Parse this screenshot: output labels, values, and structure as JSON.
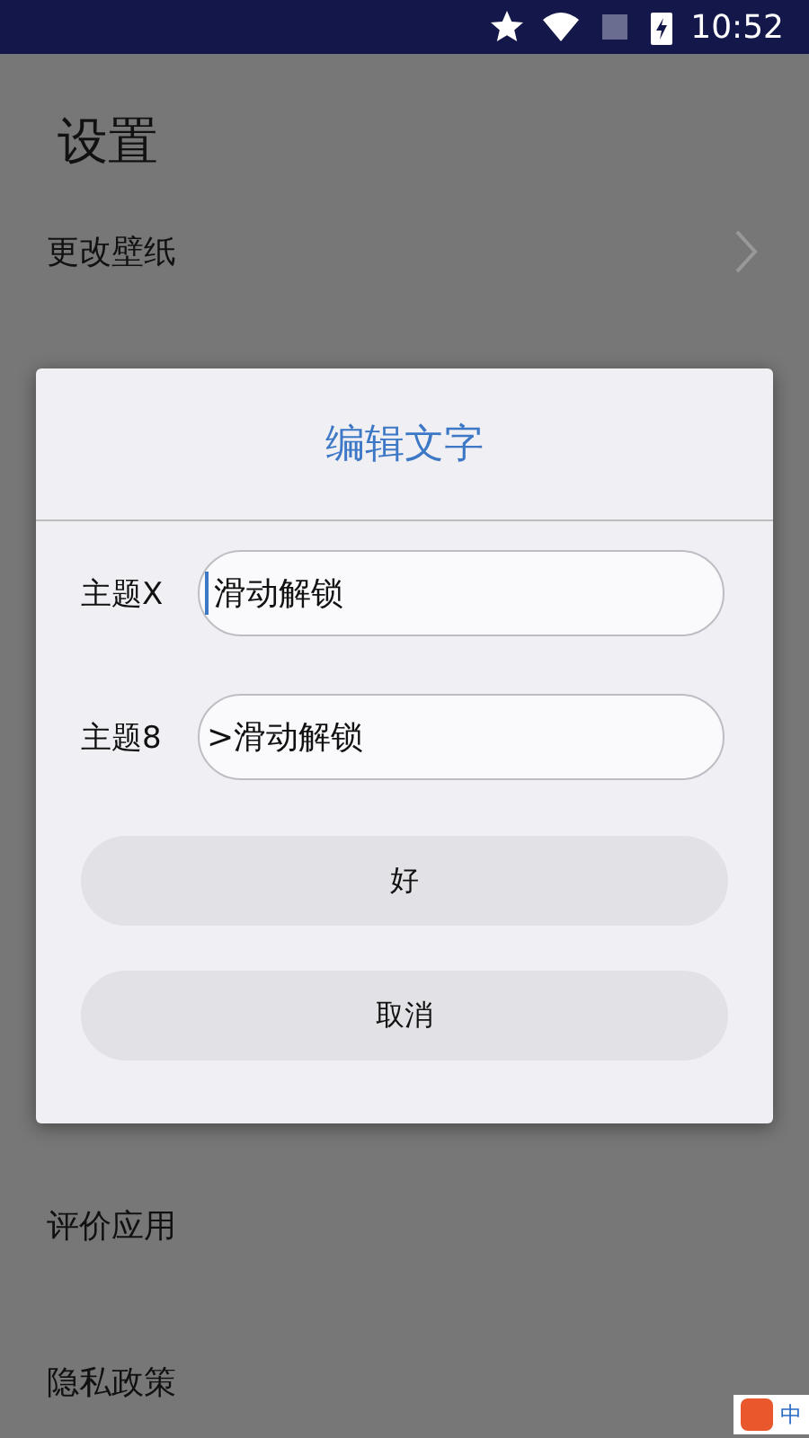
{
  "status_bar": {
    "time": "10:52"
  },
  "page": {
    "title": "设置",
    "items": [
      {
        "label": "更改壁纸",
        "chevron": true
      },
      {
        "label": "评价应用",
        "chevron": false
      },
      {
        "label": "隐私政策",
        "chevron": false
      }
    ]
  },
  "dialog": {
    "title": "编辑文字",
    "fields": [
      {
        "label": "主题X",
        "value": "滑动解锁",
        "focused": true
      },
      {
        "label": "主题8",
        "value": ">滑动解锁",
        "focused": false
      }
    ],
    "buttons": [
      "好",
      "取消"
    ]
  },
  "ime_bar": {
    "label": "中"
  }
}
